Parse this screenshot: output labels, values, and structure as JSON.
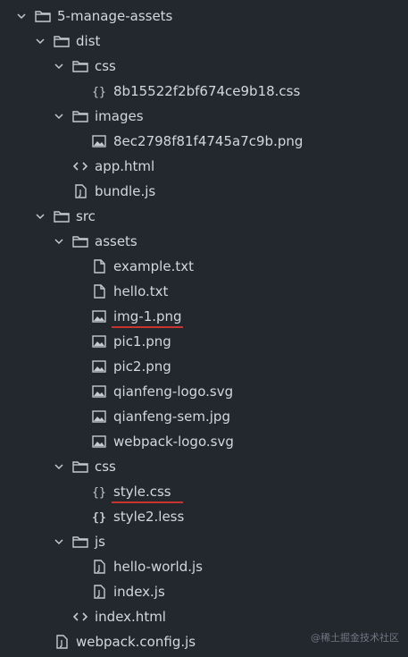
{
  "tree": [
    {
      "name": "5-manage-assets",
      "type": "folder",
      "depth": 0,
      "open": true
    },
    {
      "name": "dist",
      "type": "folder",
      "depth": 1,
      "open": true
    },
    {
      "name": "css",
      "type": "folder",
      "depth": 2,
      "open": true
    },
    {
      "name": "8b15522f2bf674ce9b18.css",
      "type": "css",
      "depth": 3
    },
    {
      "name": "images",
      "type": "folder",
      "depth": 2,
      "open": true
    },
    {
      "name": "8ec2798f81f4745a7c9b.png",
      "type": "image",
      "depth": 3
    },
    {
      "name": "app.html",
      "type": "html",
      "depth": 2
    },
    {
      "name": "bundle.js",
      "type": "js",
      "depth": 2
    },
    {
      "name": "src",
      "type": "folder",
      "depth": 1,
      "open": true
    },
    {
      "name": "assets",
      "type": "folder",
      "depth": 2,
      "open": true
    },
    {
      "name": "example.txt",
      "type": "text",
      "depth": 3
    },
    {
      "name": "hello.txt",
      "type": "text",
      "depth": 3
    },
    {
      "name": "img-1.png",
      "type": "image",
      "depth": 3,
      "underlined": true
    },
    {
      "name": "pic1.png",
      "type": "image",
      "depth": 3
    },
    {
      "name": "pic2.png",
      "type": "image",
      "depth": 3
    },
    {
      "name": "qianfeng-logo.svg",
      "type": "image",
      "depth": 3
    },
    {
      "name": "qianfeng-sem.jpg",
      "type": "image",
      "depth": 3
    },
    {
      "name": "webpack-logo.svg",
      "type": "image",
      "depth": 3
    },
    {
      "name": "css",
      "type": "folder",
      "depth": 2,
      "open": true
    },
    {
      "name": "style.css",
      "type": "css",
      "depth": 3,
      "underlined": true
    },
    {
      "name": "style2.less",
      "type": "less",
      "depth": 3
    },
    {
      "name": "js",
      "type": "folder",
      "depth": 2,
      "open": true
    },
    {
      "name": "hello-world.js",
      "type": "js",
      "depth": 3
    },
    {
      "name": "index.js",
      "type": "js",
      "depth": 3
    },
    {
      "name": "index.html",
      "type": "html",
      "depth": 2
    },
    {
      "name": "webpack.config.js",
      "type": "js",
      "depth": 1
    }
  ],
  "watermark": "@稀土掘金技术社区",
  "colors": {
    "background": "#23272e",
    "text": "#d4d7dd",
    "icon": "#c5c9d0",
    "underline": "#c8352e"
  }
}
